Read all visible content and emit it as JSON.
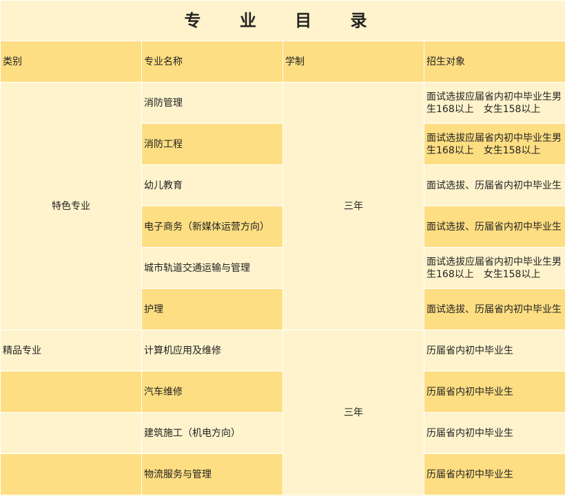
{
  "title": "专 业 目 录",
  "headers": {
    "category": "类别",
    "major": "专业名称",
    "duration": "学制",
    "target": "招生对象"
  },
  "groups": [
    {
      "category": "特色专业",
      "duration": "三年",
      "rows": [
        {
          "major": "消防管理",
          "target": "面试选拔应届省内初中毕业生男生168以上　女生158以上"
        },
        {
          "major": "消防工程",
          "target": "面试选拔应届省内初中毕业生男生168以上　女生158以上"
        },
        {
          "major": "幼儿教育",
          "target": "面试选拔、历届省内初中毕业生"
        },
        {
          "major": "电子商务（新媒体运营方向）",
          "target": "面试选拔、历届省内初中毕业生"
        },
        {
          "major": "城市轨道交通运输与管理",
          "target": "面试选拔应届省内初中毕业生男生168以上　女生158以上"
        },
        {
          "major": "护理",
          "target": "面试选拔、历届省内初中毕业生"
        }
      ]
    },
    {
      "category": "精品专业",
      "duration": "三年",
      "rows": [
        {
          "major": "计算机应用及维修",
          "target": "历届省内初中毕业生"
        },
        {
          "major": "汽车维修",
          "target": "历届省内初中毕业生"
        },
        {
          "major": "建筑施工（机电方向）",
          "target": "历届省内初中毕业生"
        },
        {
          "major": "物流服务与管理",
          "target": "历届省内初中毕业生"
        }
      ]
    }
  ]
}
